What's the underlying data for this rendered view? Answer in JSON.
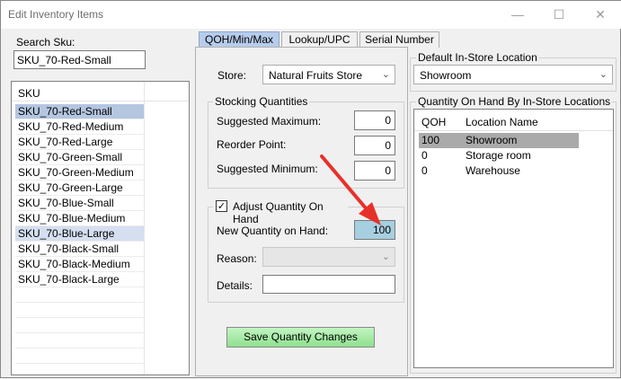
{
  "window": {
    "title": "Edit Inventory Items",
    "minimize": "—",
    "maximize": "☐",
    "close": "✕"
  },
  "search": {
    "label": "Search Sku:",
    "value": "SKU_70-Red-Small"
  },
  "sku_list": {
    "header": "SKU",
    "items": [
      "SKU_70-Red-Small",
      "SKU_70-Red-Medium",
      "SKU_70-Red-Large",
      "SKU_70-Green-Small",
      "SKU_70-Green-Medium",
      "SKU_70-Green-Large",
      "SKU_70-Blue-Small",
      "SKU_70-Blue-Medium",
      "SKU_70-Blue-Large",
      "SKU_70-Black-Small",
      "SKU_70-Black-Medium",
      "SKU_70-Black-Large"
    ]
  },
  "tabs": [
    "QOH/Min/Max",
    "Lookup/UPC",
    "Serial Number"
  ],
  "store": {
    "label": "Store:",
    "value": "Natural Fruits Store"
  },
  "stocking": {
    "title": "Stocking Quantities",
    "max_label": "Suggested Maximum:",
    "max_value": "0",
    "reorder_label": "Reorder Point:",
    "reorder_value": "0",
    "min_label": "Suggested Minimum:",
    "min_value": "0"
  },
  "adjust": {
    "checkbox_label": "Adjust Quantity On Hand",
    "checked": "✓",
    "new_qoh_label": "New Quantity on Hand:",
    "new_qoh_value": "100",
    "reason_label": "Reason:",
    "reason_value": "",
    "details_label": "Details:",
    "details_value": ""
  },
  "save_button": "Save Quantity Changes",
  "default_location": {
    "title": "Default In-Store Location",
    "value": "Showroom"
  },
  "qoh_locations": {
    "title": "Quantity On Hand By In-Store Locations",
    "headers": [
      "QOH",
      "Location Name"
    ],
    "rows": [
      [
        "100",
        "Showroom"
      ],
      [
        "0",
        "Storage room"
      ],
      [
        "0",
        "Warehouse"
      ]
    ]
  },
  "colors": {
    "annotation_arrow": "#e8302a",
    "selected_row": "#b4c6e0",
    "active_tab": "#b7ccec",
    "save_button": "#a8eca8"
  }
}
